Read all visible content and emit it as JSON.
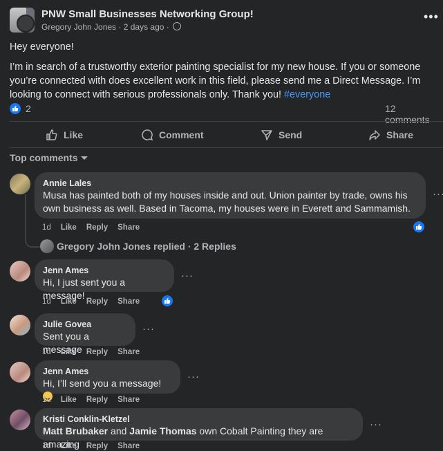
{
  "post": {
    "group_name": "PNW Small Businesses Networking Group!",
    "author": "Gregory John Jones",
    "time": "2 days ago",
    "greeting": "Hey everyone!",
    "body": "I’m in search of a trustworthy exterior painting specialist for my new house. If you or someone you’re connected with does excellent work in this field, please send me a Direct Message. I’m looking to connect with serious professionals only. Thank you! ",
    "hashtag": "#everyone",
    "reaction_count": "2",
    "comments_count": "12 comments"
  },
  "actions": {
    "like": "Like",
    "comment": "Comment",
    "send": "Send",
    "share": "Share"
  },
  "filter_label": "Top comments",
  "comment_actions": {
    "like": "Like",
    "reply": "Reply",
    "share": "Share"
  },
  "comments": [
    {
      "name": "Annie Lales",
      "text": "Musa has painted both of my houses inside and out. Union painter by trade, owns his own business as well. Based in Tacoma, my houses were in Everett and Sammamish.",
      "time": "1d"
    },
    {
      "name": "Jenn Ames",
      "text": "Hi, I just sent you a message!",
      "time": "1d"
    },
    {
      "name": "Julie Govea",
      "text": "Sent you a message",
      "time": "1d"
    },
    {
      "name": "Jenn Ames",
      "text": "Hi, I’ll send you a message! ",
      "time": "1d"
    },
    {
      "name": "Kristi Conklin-Kletzel",
      "mention1": "Matt Brubaker",
      "and": " and ",
      "mention2": "Jamie Thomas",
      "text": " own Cobalt Painting they are amazing",
      "time": "1d"
    }
  ],
  "replied_line": "Gregory John Jones replied · 2 Replies",
  "colors": {
    "background": "#242526",
    "bubble": "#3a3b3c",
    "accent": "#1877f2",
    "link": "#4599ff"
  }
}
